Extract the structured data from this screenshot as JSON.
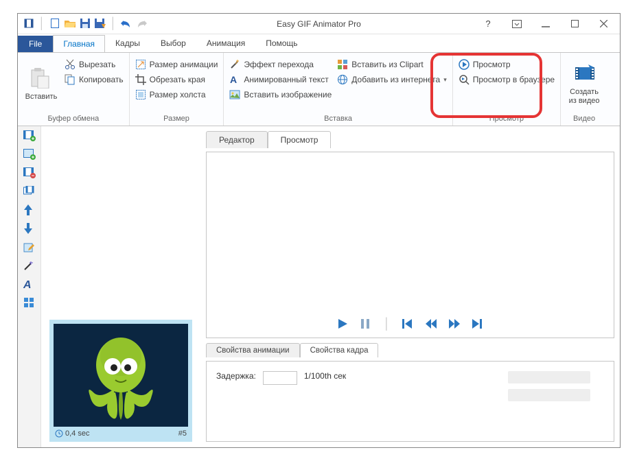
{
  "title": "Easy GIF Animator Pro",
  "file_tab": "File",
  "tabs": [
    "Главная",
    "Кадры",
    "Выбор",
    "Анимация",
    "Помощь"
  ],
  "active_tab": 0,
  "ribbon": {
    "clipboard": {
      "paste": "Вставить",
      "cut": "Вырезать",
      "copy": "Копировать",
      "label": "Буфер обмена"
    },
    "size": {
      "anim_size": "Размер анимации",
      "crop": "Обрезать края",
      "canvas_size": "Размер холста",
      "label": "Размер"
    },
    "insert": {
      "transition": "Эффект перехода",
      "anim_text": "Анимированный текст",
      "insert_image": "Вставить изображение",
      "clipart": "Вставить из Clipart",
      "internet": "Добавить из интернета",
      "label": "Вставка"
    },
    "preview": {
      "preview": "Просмотр",
      "browser": "Просмотр в браузере",
      "label": "Просмотр"
    },
    "video": {
      "create": "Создать из видео",
      "label": "Видео"
    }
  },
  "main_tabs": {
    "editor": "Редактор",
    "preview": "Просмотр",
    "active": 1
  },
  "prop_tabs": {
    "anim": "Свойства анимации",
    "frame": "Свойства кадра",
    "active": 1
  },
  "frame": {
    "duration": "0,4 sec",
    "number": "#5"
  },
  "props": {
    "delay_label": "Задержка:",
    "delay_unit": "1/100th сек",
    "delay_value": ""
  }
}
